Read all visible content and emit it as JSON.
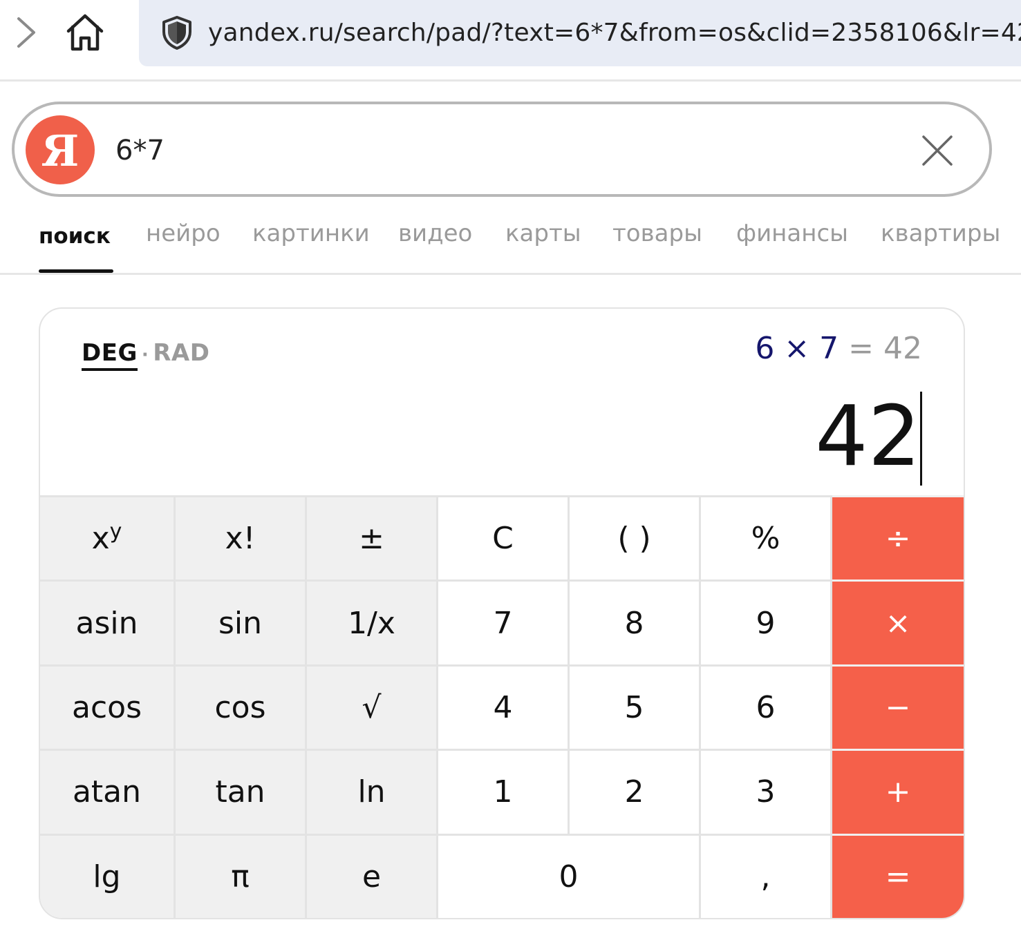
{
  "browser": {
    "url": "yandex.ru/search/pad/?text=6*7&from=os&clid=2358106&lr=42",
    "icons": {
      "forward": "chevron-right-icon",
      "home": "home-icon",
      "security": "shield-icon"
    }
  },
  "search": {
    "logo_letter": "Я",
    "query": "6*7",
    "clear_icon": "close-icon"
  },
  "tabs": [
    {
      "label": "поиск",
      "active": true
    },
    {
      "label": "нейро"
    },
    {
      "label": "картинки"
    },
    {
      "label": "видео"
    },
    {
      "label": "карты"
    },
    {
      "label": "товары"
    },
    {
      "label": "финансы"
    },
    {
      "label": "квартиры"
    }
  ],
  "calculator": {
    "mode_deg": "DEG",
    "mode_sep": "·",
    "mode_rad": "RAD",
    "history_expr": "6 × 7",
    "history_result": "= 42",
    "display": "42",
    "keys": {
      "pow_base": "x",
      "pow_exp": "y",
      "fact": "x!",
      "plusminus": "±",
      "clear": "C",
      "parens": "( )",
      "percent": "%",
      "divide": "÷",
      "asin": "asin",
      "sin": "sin",
      "inv": "1/x",
      "seven": "7",
      "eight": "8",
      "nine": "9",
      "multiply": "×",
      "acos": "acos",
      "cos": "cos",
      "sqrt": "√",
      "four": "4",
      "five": "5",
      "six": "6",
      "minus": "−",
      "atan": "atan",
      "tan": "tan",
      "ln": "ln",
      "one": "1",
      "two": "2",
      "three": "3",
      "plus": "+",
      "lg": "lg",
      "pi": "π",
      "e": "e",
      "zero": "0",
      "comma": ",",
      "equals": "="
    },
    "colors": {
      "accent": "#f5604a",
      "fn_bg": "#f0f0f0",
      "history_expr": "#15166c"
    }
  }
}
